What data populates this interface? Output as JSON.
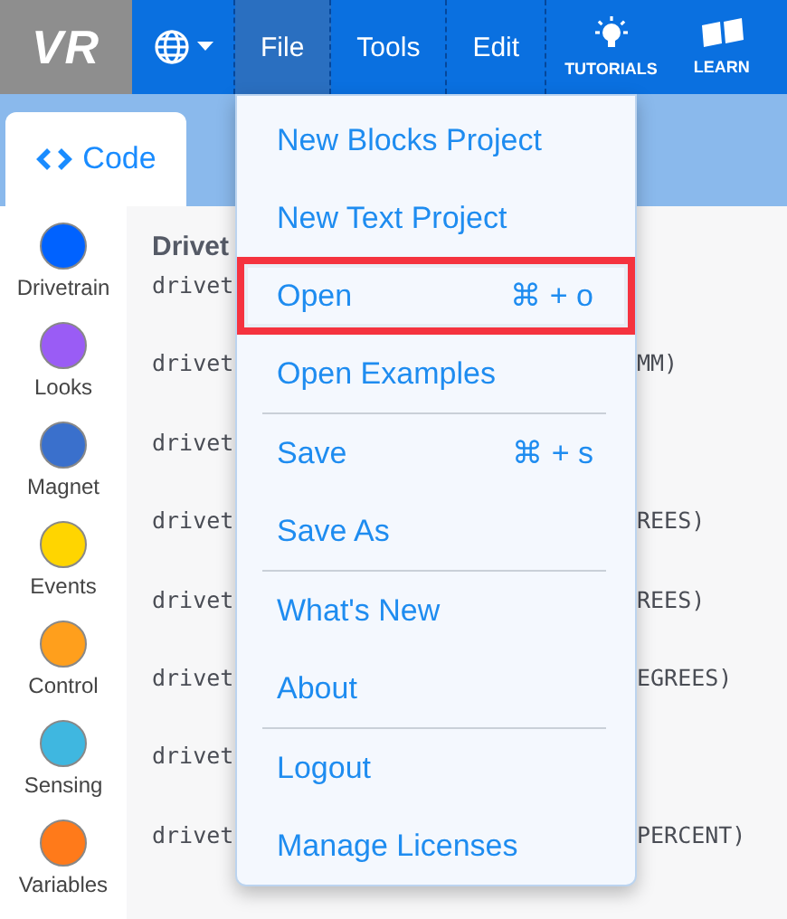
{
  "header": {
    "logo": "VR",
    "menus": [
      {
        "label": "File",
        "selected": true
      },
      {
        "label": "Tools",
        "selected": false
      },
      {
        "label": "Edit",
        "selected": false
      }
    ],
    "links": [
      {
        "label": "TUTORIALS",
        "kind": "bulb"
      },
      {
        "label": "LEARN",
        "kind": "book"
      }
    ]
  },
  "tab": {
    "label": "Code",
    "selected": true
  },
  "categories": [
    {
      "label": "Drivetrain",
      "color": "#0062ff"
    },
    {
      "label": "Looks",
      "color": "#9a5cf5"
    },
    {
      "label": "Magnet",
      "color": "#3a70cc"
    },
    {
      "label": "Events",
      "color": "#ffd500"
    },
    {
      "label": "Control",
      "color": "#ff9f1c"
    },
    {
      "label": "Sensing",
      "color": "#3fb7e0"
    },
    {
      "label": "Variables",
      "color": "#ff7a1a"
    }
  ],
  "code": {
    "heading": "Drivet",
    "lines": [
      {
        "left": "drivet"
      },
      {
        "left": "drivet",
        "right": "MM)"
      },
      {
        "left": "drivet"
      },
      {
        "left": "drivet",
        "right": "REES)"
      },
      {
        "left": "drivet",
        "right": "REES)"
      },
      {
        "left": "drivet",
        "right": "EGREES)"
      },
      {
        "left": "drivet"
      },
      {
        "left": "drivet",
        "right": "PERCENT)"
      }
    ]
  },
  "file_menu": {
    "items": [
      {
        "label": "New Blocks Project",
        "highlighted": false,
        "divider_after": false
      },
      {
        "label": "New Text Project",
        "highlighted": false,
        "divider_after": false
      },
      {
        "label": "Open",
        "shortcut": "⌘ + o",
        "highlighted": true,
        "divider_after": false
      },
      {
        "label": "Open Examples",
        "highlighted": false,
        "divider_after": true
      },
      {
        "label": "Save",
        "shortcut": "⌘ + s",
        "highlighted": false,
        "divider_after": false
      },
      {
        "label": "Save As",
        "highlighted": false,
        "divider_after": true
      },
      {
        "label": "What's New",
        "highlighted": false,
        "divider_after": false
      },
      {
        "label": "About",
        "highlighted": false,
        "divider_after": true
      },
      {
        "label": "Logout",
        "highlighted": false,
        "divider_after": false
      },
      {
        "label": "Manage Licenses",
        "highlighted": false,
        "divider_after": false
      }
    ]
  }
}
